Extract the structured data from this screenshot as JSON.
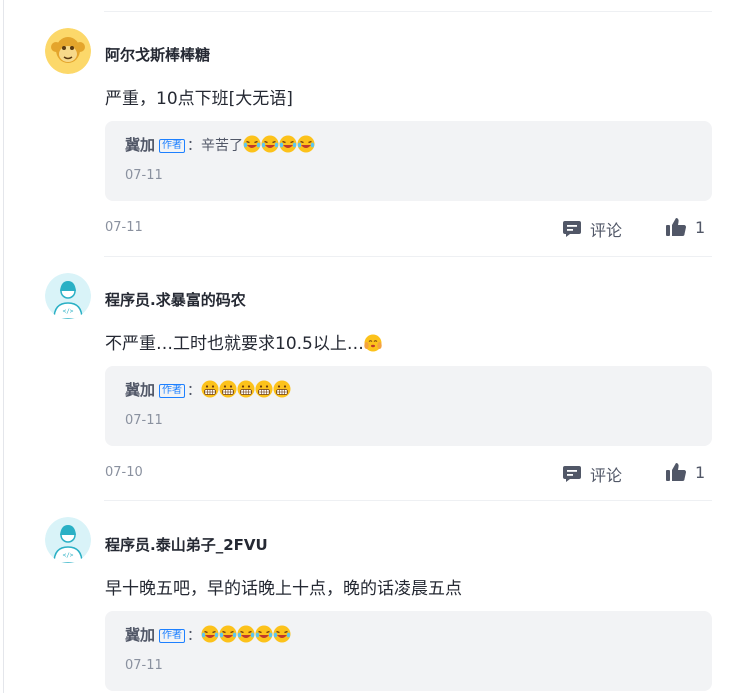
{
  "comments": [
    {
      "author": "阿尔戈斯棒棒糖",
      "avatar_icon": "cartoon-monkey-icon",
      "content": "严重，10点下班[大无语]",
      "content_emoji_count": 0,
      "reply": {
        "name": "冀加",
        "badge": "作者",
        "sep": "：",
        "text": "辛苦了",
        "emoji": "laughing-tears-emoji",
        "emoji_count": 4,
        "date": "07-11"
      },
      "date": "07-11",
      "comment_label": "评论",
      "like_count": "1"
    },
    {
      "author": "程序员.求暴富的码农",
      "avatar_icon": "programmer-avatar-icon",
      "content": "不严重…工时也就要求10.5以上…",
      "content_emoji": "hands-cheek-emoji",
      "reply": {
        "name": "冀加",
        "badge": "作者",
        "sep": "：",
        "text": "",
        "emoji": "grimacing-emoji",
        "emoji_count": 5,
        "date": "07-11"
      },
      "date": "07-10",
      "comment_label": "评论",
      "like_count": "1"
    },
    {
      "author": "程序员.泰山弟子_2FVU",
      "avatar_icon": "programmer-avatar-icon",
      "content": "早十晚五吧，早的话晚上十点，晚的话凌晨五点",
      "reply": {
        "name": "冀加",
        "badge": "作者",
        "sep": "：",
        "text": "",
        "emoji": "laughing-tears-emoji",
        "emoji_count": 5,
        "date": "07-11"
      }
    }
  ],
  "colors": {
    "accent": "#1e80ff",
    "reply_bg": "#f2f3f5",
    "muted": "#8a919f"
  }
}
